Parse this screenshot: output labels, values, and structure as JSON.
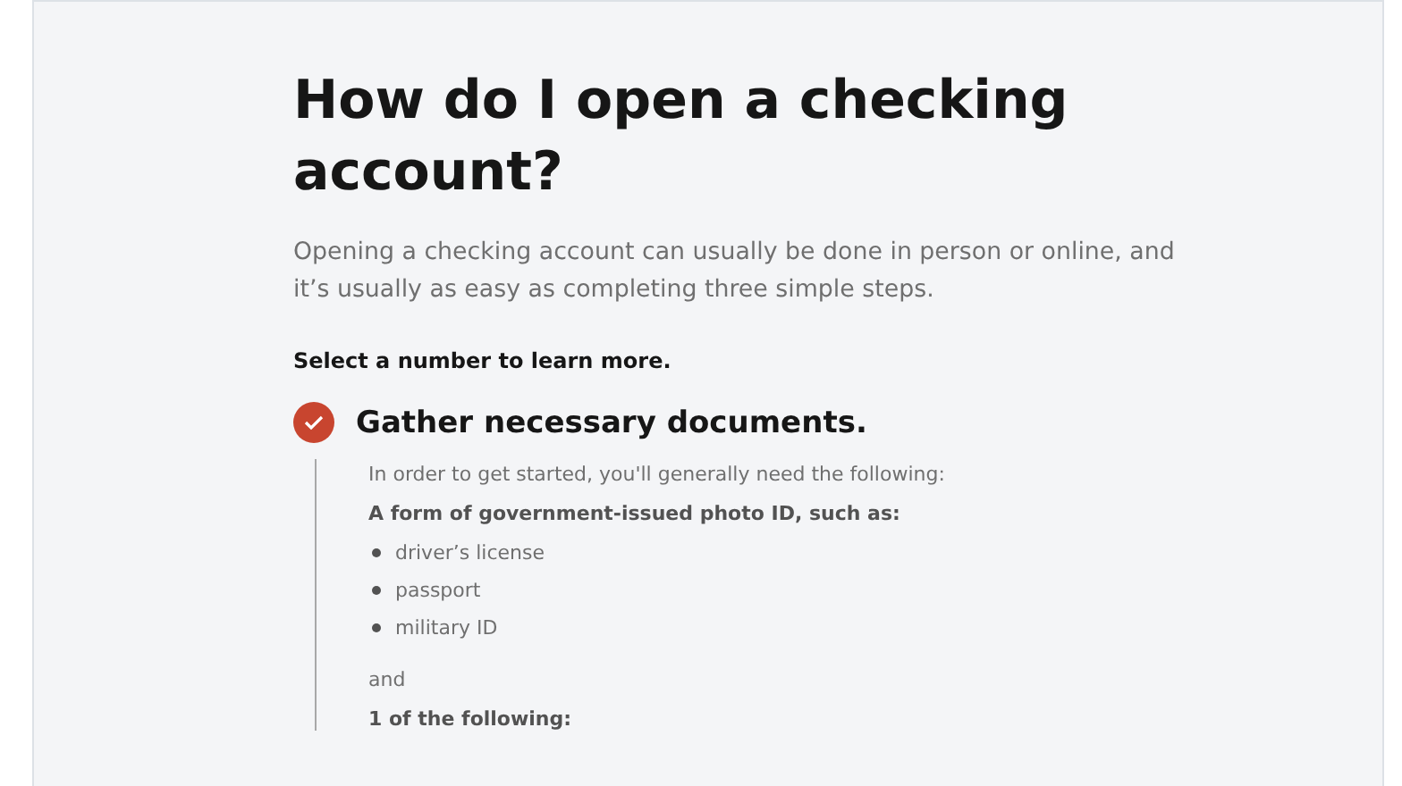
{
  "heading": "How do I open a checking account?",
  "intro": "Opening a checking account can usually be done in person or online, and it’s usually as easy as completing three simple steps.",
  "prompt": "Select a number to learn more.",
  "steps": [
    {
      "title": "Gather necessary documents.",
      "completed": true,
      "intro": "In order to get started, you'll generally need the following:",
      "subheading": "A form of government-issued photo ID, such as:",
      "items": [
        "driver’s license",
        "passport",
        "military ID"
      ],
      "connector": "and",
      "next_subheading": "1 of the following:"
    }
  ]
}
